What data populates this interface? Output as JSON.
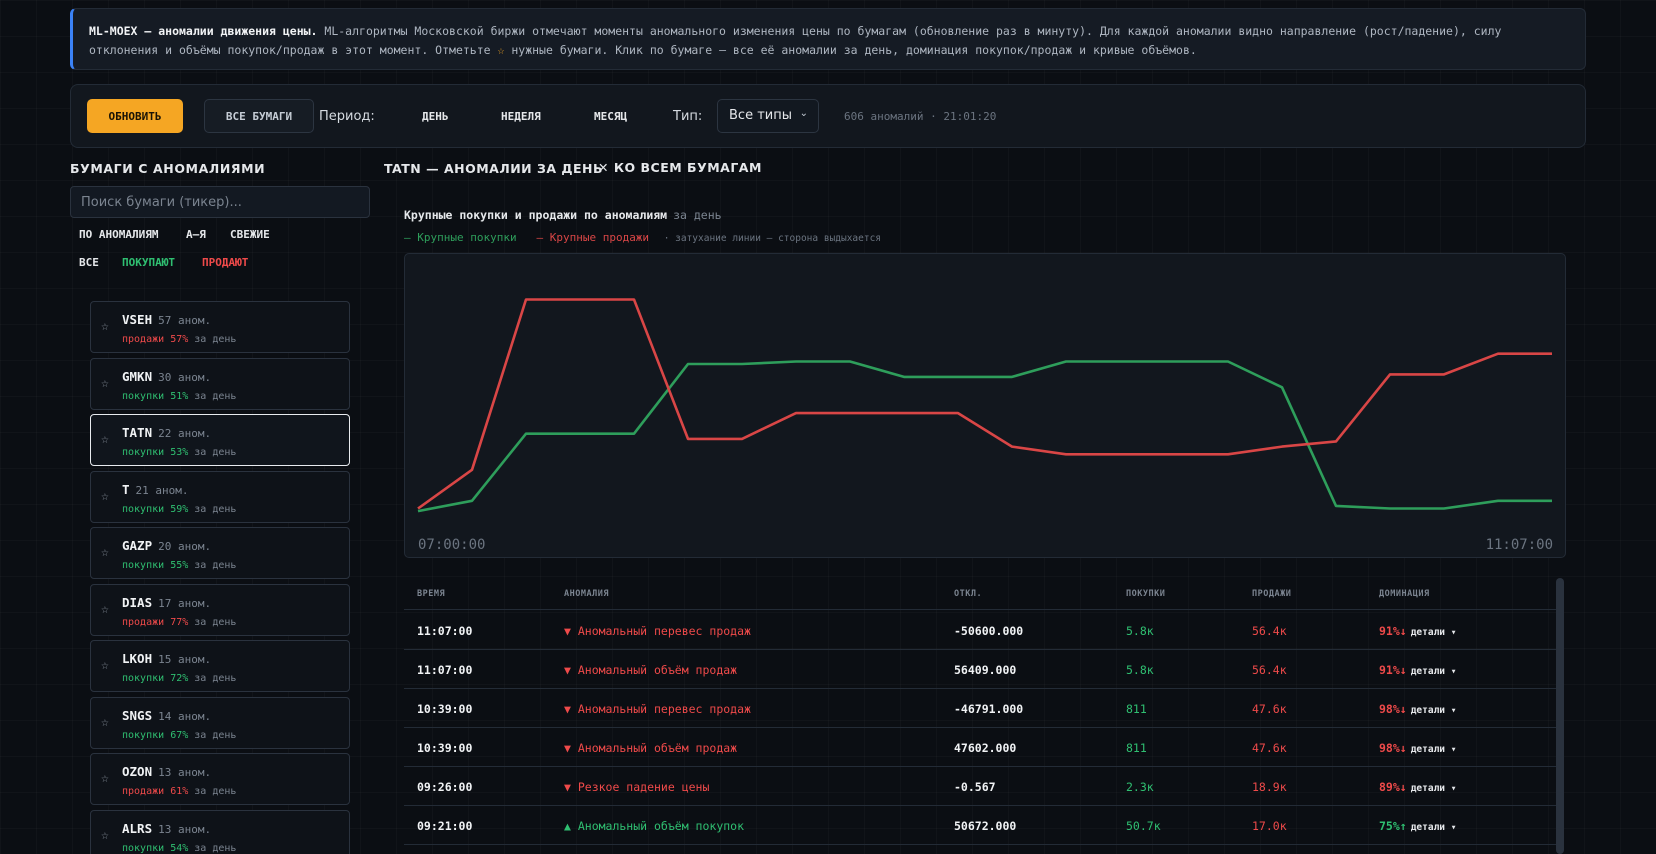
{
  "banner": {
    "title": "ML-MOEX — аномалии движения цены.",
    "text_before_star": " ML-алгоритмы Московской биржи отмечают моменты аномального изменения цены по бумагам (обновление раз в минуту). Для каждой аномалии видно направление (рост/падение), силу отклонения и объёмы покупок/продаж в этот момент. Отметьте ",
    "star": "☆",
    "text_after_star": " нужные бумаги. Клик по бумаге — все её аномалии за день, доминация покупок/продаж и кривые объёмов."
  },
  "toolbar": {
    "refresh_label": "ОБНОВИТЬ",
    "all_label": "ВСЕ БУМАГИ",
    "period_label": "Период:",
    "periods": [
      "ДЕНЬ",
      "НЕДЕЛЯ",
      "МЕСЯЦ"
    ],
    "type_label": "Тип:",
    "type_value": "Все типы",
    "chevron": "⌄",
    "status": "606 аномалий · 21:01:20"
  },
  "sidebar": {
    "title": "БУМАГИ С АНОМАЛИЯМИ",
    "search_placeholder": "Поиск бумаги (тикер)...",
    "sort_options": [
      "ПО АНОМАЛИЯМ",
      "А–Я",
      "СВЕЖИЕ"
    ],
    "filters": {
      "all": "ВСЕ",
      "buy": "ПОКУПАЮТ",
      "sell": "ПРОДАЮТ"
    },
    "star_icon": "☆",
    "count_suffix": "аном.",
    "period_suffix": "за день",
    "items": [
      {
        "ticker": "VSEH",
        "count": "57",
        "side": "продажи",
        "pct": "57%",
        "dir": "sell"
      },
      {
        "ticker": "GMKN",
        "count": "30",
        "side": "покупки",
        "pct": "51%",
        "dir": "buy"
      },
      {
        "ticker": "TATN",
        "count": "22",
        "side": "покупки",
        "pct": "53%",
        "dir": "buy",
        "selected": true
      },
      {
        "ticker": "T",
        "count": "21",
        "side": "покупки",
        "pct": "59%",
        "dir": "buy"
      },
      {
        "ticker": "GAZP",
        "count": "20",
        "side": "покупки",
        "pct": "55%",
        "dir": "buy"
      },
      {
        "ticker": "DIAS",
        "count": "17",
        "side": "продажи",
        "pct": "77%",
        "dir": "sell"
      },
      {
        "ticker": "LKOH",
        "count": "15",
        "side": "покупки",
        "pct": "72%",
        "dir": "buy"
      },
      {
        "ticker": "SNGS",
        "count": "14",
        "side": "покупки",
        "pct": "67%",
        "dir": "buy"
      },
      {
        "ticker": "OZON",
        "count": "13",
        "side": "продажи",
        "pct": "61%",
        "dir": "sell"
      },
      {
        "ticker": "ALRS",
        "count": "13",
        "side": "покупки",
        "pct": "54%",
        "dir": "buy"
      }
    ]
  },
  "main": {
    "title": "TATN — АНОМАЛИИ ЗА ДЕНЬ",
    "back_label": "✕ КО ВСЕМ БУМАГАМ"
  },
  "chart_data": {
    "type": "line",
    "title": "Крупные покупки и продажи по аномалиям",
    "subtitle": "за день",
    "legend_note": "· затухание линии — сторона выдыхается",
    "x_start": "07:00:00",
    "x_end": "11:07:00",
    "ylim": [
      0,
      100
    ],
    "series": [
      {
        "name": "Крупные покупки",
        "color": "#2e9e5b",
        "values": [
          5,
          9,
          35,
          35,
          35,
          62,
          62,
          63,
          63,
          57,
          57,
          57,
          63,
          63,
          63,
          63,
          53,
          7,
          6,
          6,
          9,
          9
        ]
      },
      {
        "name": "Крупные продажи",
        "color": "#d94646",
        "values": [
          6,
          21,
          87,
          87,
          87,
          33,
          33,
          43,
          43,
          43,
          43,
          30,
          27,
          27,
          27,
          27,
          30,
          32,
          58,
          58,
          66,
          66
        ]
      }
    ]
  },
  "table": {
    "headers": [
      "ВРЕМЯ",
      "АНОМАЛИЯ",
      "ОТКЛ.",
      "ПОКУПКИ",
      "ПРОДАЖИ",
      "ДОМИНАЦИЯ"
    ],
    "details_label": "детали ▾",
    "rows": [
      {
        "time": "11:07:00",
        "anomaly": "▼ Аномальный перевес продаж",
        "dir": "sell",
        "dev": "-50600.000",
        "buy": "5.8к",
        "sell": "56.4к",
        "dom": "91%↓"
      },
      {
        "time": "11:07:00",
        "anomaly": "▼ Аномальный объём продаж",
        "dir": "sell",
        "dev": "56409.000",
        "buy": "5.8к",
        "sell": "56.4к",
        "dom": "91%↓"
      },
      {
        "time": "10:39:00",
        "anomaly": "▼ Аномальный перевес продаж",
        "dir": "sell",
        "dev": "-46791.000",
        "buy": "811",
        "sell": "47.6к",
        "dom": "98%↓"
      },
      {
        "time": "10:39:00",
        "anomaly": "▼ Аномальный объём продаж",
        "dir": "sell",
        "dev": "47602.000",
        "buy": "811",
        "sell": "47.6к",
        "dom": "98%↓"
      },
      {
        "time": "09:26:00",
        "anomaly": "▼ Резкое падение цены",
        "dir": "sell",
        "dev": "-0.567",
        "buy": "2.3к",
        "sell": "18.9к",
        "dom": "89%↓"
      },
      {
        "time": "09:21:00",
        "anomaly": "▲ Аномальный объём покупок",
        "dir": "buy",
        "dev": "50672.000",
        "buy": "50.7к",
        "sell": "17.0к",
        "dom": "75%↑"
      }
    ]
  }
}
